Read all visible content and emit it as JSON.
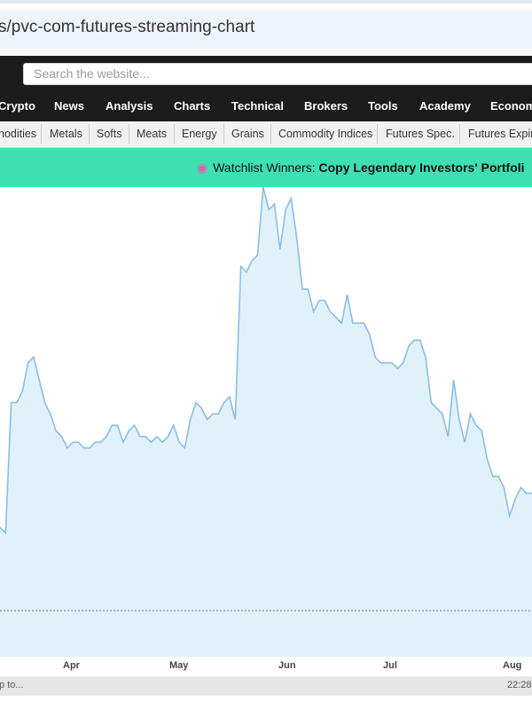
{
  "browser": {
    "url_fragment": "s/pvc-com-futures-streaming-chart"
  },
  "header": {
    "search_placeholder": "Search the website..."
  },
  "main_nav": [
    "Crypto",
    "News",
    "Analysis",
    "Charts",
    "Technical",
    "Brokers",
    "Tools",
    "Academy",
    "Econom"
  ],
  "sub_nav": [
    "nodities",
    "Metals",
    "Softs",
    "Meats",
    "Energy",
    "Grains",
    "Commodity Indices",
    "Futures Spec.",
    "Futures Expir"
  ],
  "banner": {
    "icon": "brain-icon",
    "label": "Watchlist Winners:",
    "cta": "Copy Legendary Investors' Portfoli"
  },
  "chart_data": {
    "type": "area",
    "x_axis_labels": [
      "Apr",
      "May",
      "Jun",
      "Jul",
      "Aug"
    ],
    "series_color": "#8bbde6",
    "fill_color": "#e1f1fa",
    "reference_line": "dotted",
    "values": [
      0.4,
      0.39,
      0.62,
      0.62,
      0.64,
      0.69,
      0.7,
      0.66,
      0.62,
      0.6,
      0.57,
      0.56,
      0.54,
      0.55,
      0.55,
      0.54,
      0.54,
      0.55,
      0.55,
      0.56,
      0.58,
      0.58,
      0.55,
      0.57,
      0.58,
      0.56,
      0.56,
      0.55,
      0.56,
      0.55,
      0.56,
      0.58,
      0.55,
      0.54,
      0.59,
      0.62,
      0.61,
      0.59,
      0.6,
      0.6,
      0.62,
      0.63,
      0.59,
      0.86,
      0.85,
      0.87,
      0.88,
      1.0,
      0.96,
      0.97,
      0.89,
      0.96,
      0.98,
      0.91,
      0.82,
      0.82,
      0.78,
      0.8,
      0.8,
      0.78,
      0.77,
      0.76,
      0.81,
      0.76,
      0.76,
      0.76,
      0.74,
      0.7,
      0.69,
      0.69,
      0.69,
      0.68,
      0.69,
      0.72,
      0.73,
      0.73,
      0.7,
      0.62,
      0.61,
      0.6,
      0.56,
      0.66,
      0.59,
      0.55,
      0.6,
      0.58,
      0.57,
      0.52,
      0.49,
      0.49,
      0.47,
      0.42,
      0.45,
      0.47,
      0.46,
      0.46
    ]
  },
  "status": {
    "left": "p to...",
    "right": "22:28"
  }
}
